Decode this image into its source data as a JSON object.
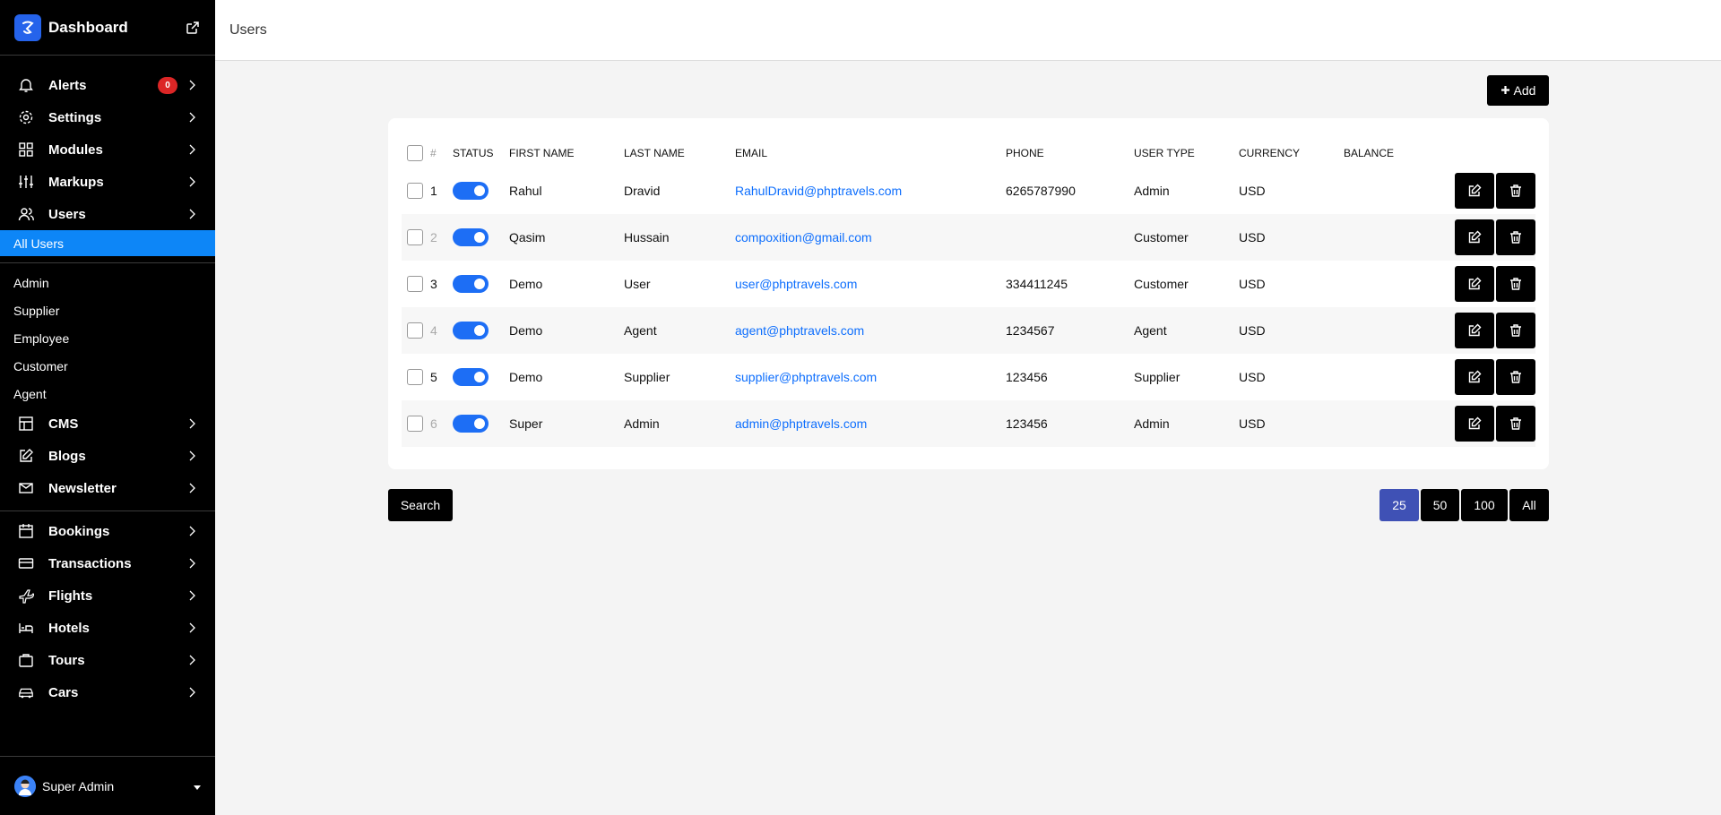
{
  "sidebar": {
    "brand": "Dashboard",
    "alerts_count": "0",
    "items_top": [
      {
        "label": "Alerts",
        "icon": "bell-icon"
      },
      {
        "label": "Settings",
        "icon": "gear-icon"
      },
      {
        "label": "Modules",
        "icon": "grid-icon"
      },
      {
        "label": "Markups",
        "icon": "sliders-icon"
      },
      {
        "label": "Users",
        "icon": "users-icon"
      }
    ],
    "users_active": "All Users",
    "users_sub": [
      "Admin",
      "Supplier",
      "Employee",
      "Customer",
      "Agent"
    ],
    "items_mid": [
      {
        "label": "CMS",
        "icon": "layout-icon"
      },
      {
        "label": "Blogs",
        "icon": "edit-icon"
      },
      {
        "label": "Newsletter",
        "icon": "mail-icon"
      }
    ],
    "items_bottom": [
      {
        "label": "Bookings",
        "icon": "calendar-icon"
      },
      {
        "label": "Transactions",
        "icon": "credit-card-icon"
      },
      {
        "label": "Flights",
        "icon": "plane-icon"
      },
      {
        "label": "Hotels",
        "icon": "bed-icon"
      },
      {
        "label": "Tours",
        "icon": "briefcase-icon"
      },
      {
        "label": "Cars",
        "icon": "car-icon"
      }
    ],
    "footer_user": "Super Admin"
  },
  "header": {
    "title": "Users"
  },
  "main": {
    "add_label": "Add",
    "columns": [
      "#",
      "Status",
      "First Name",
      "Last Name",
      "Email",
      "Phone",
      "User Type",
      "Currency",
      "Balance"
    ],
    "rows": [
      {
        "num": "1",
        "first": "Rahul",
        "last": "Dravid",
        "email": "RahulDravid@phptravels.com",
        "phone": "6265787990",
        "type": "Admin",
        "currency": "USD",
        "balance": ""
      },
      {
        "num": "2",
        "first": "Qasim",
        "last": "Hussain",
        "email": "compoxition@gmail.com",
        "phone": "",
        "type": "Customer",
        "currency": "USD",
        "balance": ""
      },
      {
        "num": "3",
        "first": "Demo",
        "last": "User",
        "email": "user@phptravels.com",
        "phone": "334411245",
        "type": "Customer",
        "currency": "USD",
        "balance": ""
      },
      {
        "num": "4",
        "first": "Demo",
        "last": "Agent",
        "email": "agent@phptravels.com",
        "phone": "1234567",
        "type": "Agent",
        "currency": "USD",
        "balance": ""
      },
      {
        "num": "5",
        "first": "Demo",
        "last": "Supplier",
        "email": "supplier@phptravels.com",
        "phone": "123456",
        "type": "Supplier",
        "currency": "USD",
        "balance": ""
      },
      {
        "num": "6",
        "first": "Super",
        "last": "Admin",
        "email": "admin@phptravels.com",
        "phone": "123456",
        "type": "Admin",
        "currency": "USD",
        "balance": ""
      }
    ],
    "search_label": "Search",
    "page_sizes": [
      "25",
      "50",
      "100",
      "All"
    ],
    "active_page_size": "25"
  },
  "colors": {
    "sidebar_bg": "#000000",
    "active_item": "#0d86f7",
    "toggle_on": "#1d6ef5",
    "link": "#0d6efd",
    "pager_active": "#3f51b5",
    "badge": "#dc2626"
  }
}
